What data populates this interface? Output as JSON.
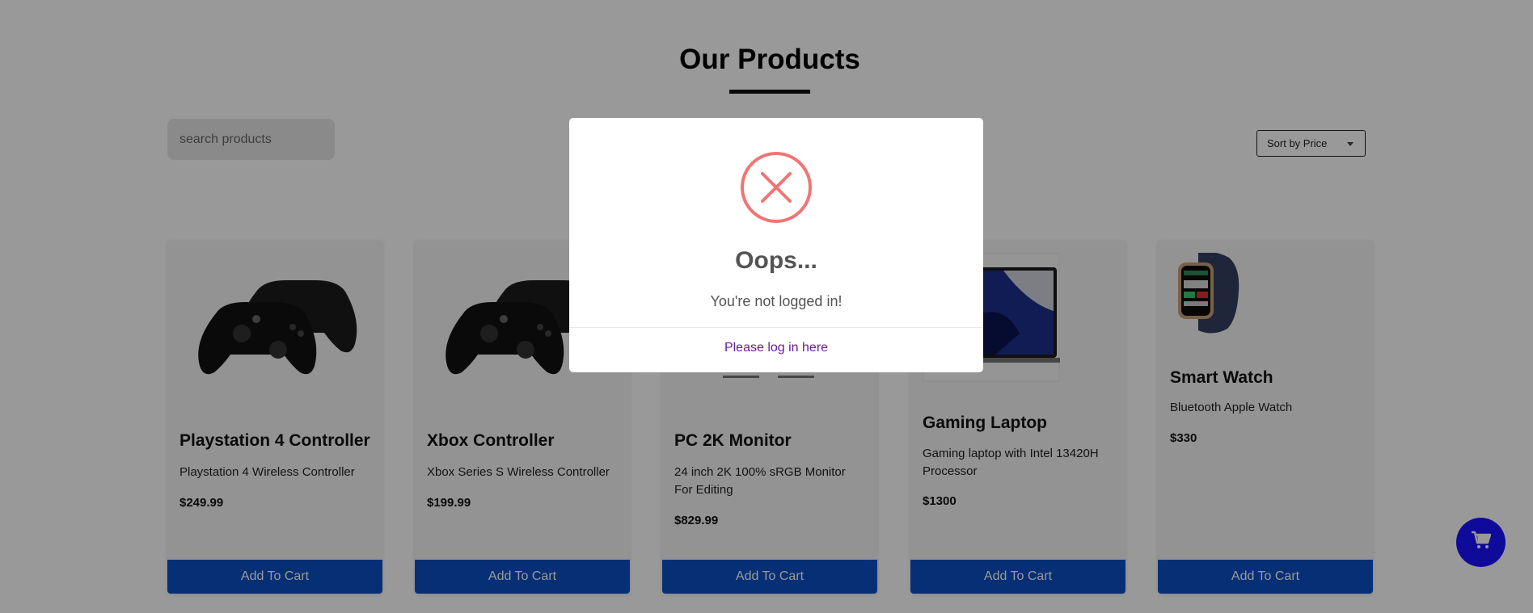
{
  "page": {
    "title": "Our Products"
  },
  "search": {
    "placeholder": "search products"
  },
  "sort": {
    "label": "Sort by Price"
  },
  "products": [
    {
      "name": "Playstation 4 Controller",
      "description": "Playstation 4 Wireless Controller",
      "price": "$249.99",
      "button": "Add To Cart",
      "image_icon": "gamepad-icon"
    },
    {
      "name": "Xbox Controller",
      "description": "Xbox Series S Wireless Controller",
      "price": "$199.99",
      "button": "Add To Cart",
      "image_icon": "gamepad-icon"
    },
    {
      "name": "PC 2K Monitor",
      "description": "24 inch 2K 100% sRGB Monitor For Editing",
      "price": "$829.99",
      "button": "Add To Cart",
      "image_icon": "monitor-icon"
    },
    {
      "name": "Gaming Laptop",
      "description": "Gaming laptop with Intel 13420H Processor",
      "price": "$1300",
      "button": "Add To Cart",
      "image_icon": "laptop-icon"
    },
    {
      "name": "Smart Watch",
      "description": "Bluetooth Apple Watch",
      "price": "$330",
      "button": "Add To Cart",
      "image_icon": "smartwatch-icon"
    }
  ],
  "cart_fab": {
    "icon": "cart-icon",
    "color": "#1a11ff"
  },
  "modal": {
    "icon": "error-x-icon",
    "title": "Oops...",
    "text": "You're not logged in!",
    "link": "Please log in here",
    "icon_color": "#f27474"
  },
  "colors": {
    "button": "#0b4fc4",
    "link": "#6a1b9a"
  }
}
